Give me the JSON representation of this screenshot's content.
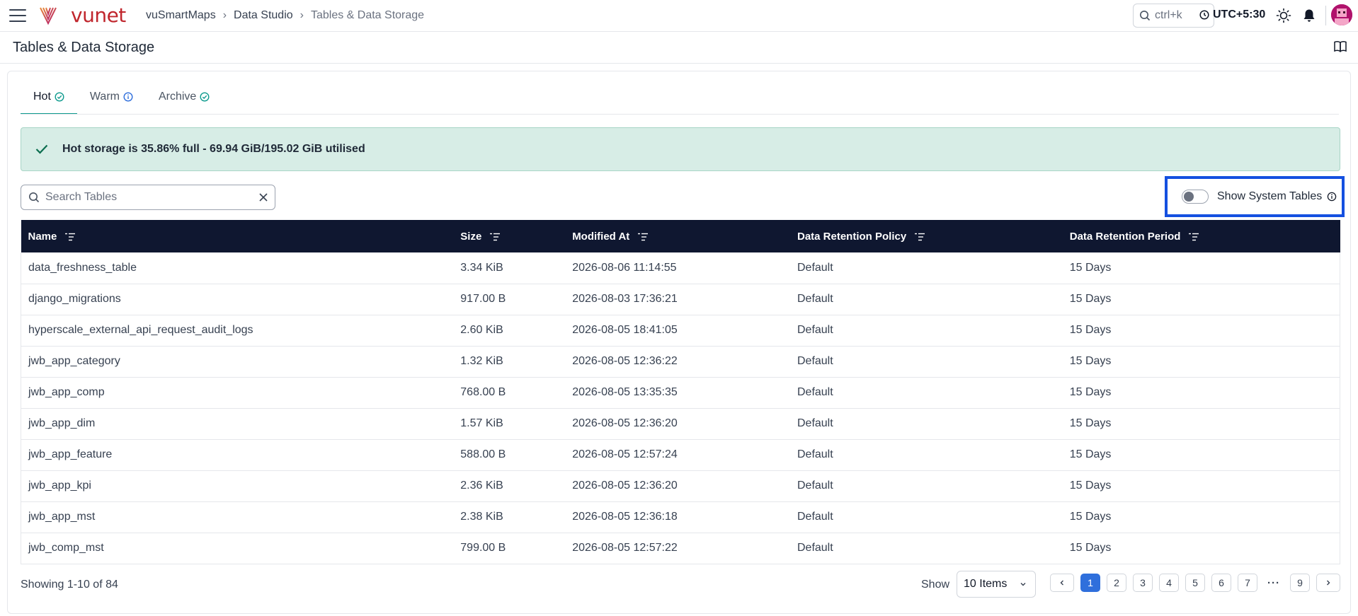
{
  "nav": {
    "logo_text": "vunet",
    "breadcrumb": [
      "vuSmartMaps",
      "Data Studio",
      "Tables & Data Storage"
    ],
    "search_label": "ctrl+k",
    "timezone": "UTC+5:30"
  },
  "page": {
    "title": "Tables & Data Storage"
  },
  "tabs": [
    {
      "label": "Hot",
      "icon": "check-circle-icon",
      "active": true
    },
    {
      "label": "Warm",
      "icon": "info-icon",
      "active": false
    },
    {
      "label": "Archive",
      "icon": "check-circle-icon",
      "active": false
    }
  ],
  "alert": {
    "text": "Hot storage is 35.86% full - 69.94 GiB/195.02 GiB utilised",
    "color": "#d7ede6"
  },
  "search": {
    "placeholder": "Search Tables",
    "value": ""
  },
  "system_tables": {
    "label": "Show System Tables",
    "enabled": false
  },
  "table": {
    "columns": [
      "Name",
      "Size",
      "Modified At",
      "Data Retention Policy",
      "Data Retention Period"
    ],
    "rows": [
      [
        "data_freshness_table",
        "3.34 KiB",
        "2026-08-06 11:14:55",
        "Default",
        "15 Days"
      ],
      [
        "django_migrations",
        "917.00 B",
        "2026-08-03 17:36:21",
        "Default",
        "15 Days"
      ],
      [
        "hyperscale_external_api_request_audit_logs",
        "2.60 KiB",
        "2026-08-05 18:41:05",
        "Default",
        "15 Days"
      ],
      [
        "jwb_app_category",
        "1.32 KiB",
        "2026-08-05 12:36:22",
        "Default",
        "15 Days"
      ],
      [
        "jwb_app_comp",
        "768.00 B",
        "2026-08-05 13:35:35",
        "Default",
        "15 Days"
      ],
      [
        "jwb_app_dim",
        "1.57 KiB",
        "2026-08-05 12:36:20",
        "Default",
        "15 Days"
      ],
      [
        "jwb_app_feature",
        "588.00 B",
        "2026-08-05 12:57:24",
        "Default",
        "15 Days"
      ],
      [
        "jwb_app_kpi",
        "2.36 KiB",
        "2026-08-05 12:36:20",
        "Default",
        "15 Days"
      ],
      [
        "jwb_app_mst",
        "2.38 KiB",
        "2026-08-05 12:36:18",
        "Default",
        "15 Days"
      ],
      [
        "jwb_comp_mst",
        "799.00 B",
        "2026-08-05 12:57:22",
        "Default",
        "15 Days"
      ]
    ]
  },
  "footer": {
    "showing": "Showing 1-10 of 84",
    "show_label": "Show",
    "items_per_page": "10 Items",
    "pages": [
      "1",
      "2",
      "3",
      "4",
      "5",
      "6",
      "7",
      "9"
    ],
    "ellipsis": "···",
    "current_page": "1"
  },
  "colors": {
    "header_bg": "#0f1730",
    "accent_teal": "#0f9b8e",
    "active_page": "#2f6fdc",
    "highlight_border": "#1450e0",
    "brand": "#c0262d"
  }
}
